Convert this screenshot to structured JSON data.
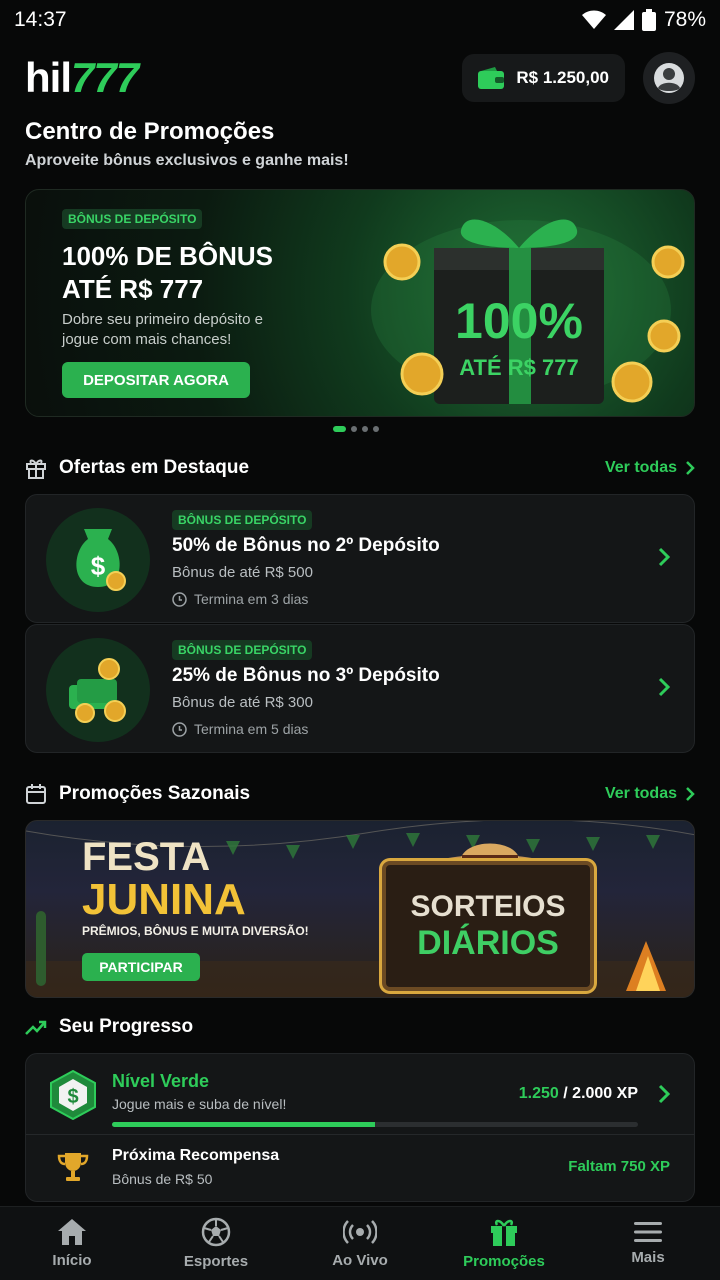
{
  "status_bar": {
    "time": "14:37",
    "battery": "78%"
  },
  "header": {
    "logo_left": "hil",
    "logo_right": "777",
    "balance": "R$ 1.250,00"
  },
  "page": {
    "title": "Centro de Promoções",
    "subtitle": "Aproveite bônus exclusivos e ganhe mais!"
  },
  "hero": {
    "tag": "BÔNUS DE DEPÓSITO",
    "title": "100% DE BÔNUS ATÉ R$ 777",
    "desc": "Dobre seu primeiro depósito e jogue com mais chances!",
    "button": "DEPOSITAR AGORA",
    "art_big": "100%",
    "art_small": "ATÉ R$ 777",
    "carousel_active": 1,
    "carousel_count": 4
  },
  "featured": {
    "title": "Ofertas em Destaque",
    "see_all": "Ver todas",
    "offers": [
      {
        "tag": "BÔNUS DE DEPÓSITO",
        "title": "50% de Bônus no 2º Depósito",
        "subtitle": "Bônus de até R$ 500",
        "ends": "Termina em 3 dias",
        "icon": "money-bag-icon"
      },
      {
        "tag": "BÔNUS DE DEPÓSITO",
        "title": "25% de Bônus no 3º Depósito",
        "subtitle": "Bônus de até R$ 300",
        "ends": "Termina em 5 dias",
        "icon": "coins-stack-icon"
      }
    ]
  },
  "seasonal": {
    "title": "Promoções Sazonais",
    "see_all": "Ver todas",
    "banner": {
      "line1": "FESTA",
      "line2": "JUNINA",
      "tagline": "PRÊMIOS, BÔNUS E MUITA DIVERSÃO!",
      "button": "PARTICIPAR",
      "sign_top": "SORTEIOS",
      "sign_bottom": "DIÁRIOS"
    }
  },
  "progress": {
    "title": "Seu Progresso",
    "level": "Nível Verde",
    "level_sub": "Jogue mais e suba de nível!",
    "xp_current": "1.250",
    "xp_total": " / 2.000 XP",
    "progress_fraction": 0.5,
    "reward_title": "Próxima Recompensa",
    "reward_sub": "Bônus de R$ 50",
    "reward_remaining": "Faltam 750 XP"
  },
  "bottom_nav": {
    "items": [
      {
        "label": "Início",
        "icon": "home-icon"
      },
      {
        "label": "Esportes",
        "icon": "soccer-ball-icon"
      },
      {
        "label": "Ao Vivo",
        "icon": "live-broadcast-icon"
      },
      {
        "label": "Promoções",
        "icon": "gift-icon",
        "active": true
      },
      {
        "label": "Mais",
        "icon": "menu-icon"
      }
    ]
  },
  "colors": {
    "accent": "#2ecc5a",
    "background": "#070808",
    "card": "#141617"
  }
}
